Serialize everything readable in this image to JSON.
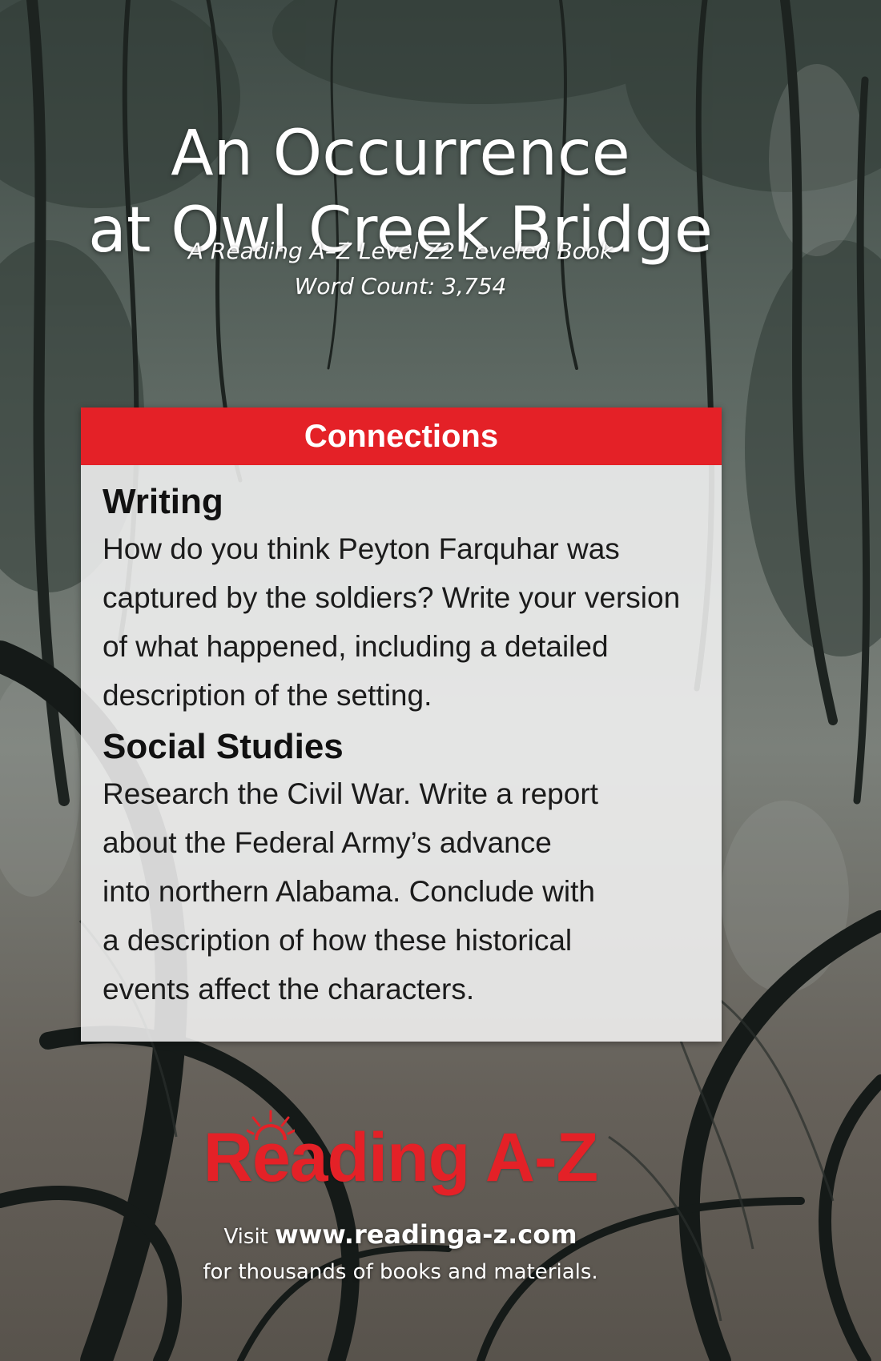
{
  "cover": {
    "title_line_1": "An Occurrence",
    "title_line_2": "at Owl Creek Bridge",
    "subtitle_line_1": "A Reading A–Z Level Z2 Leveled Book",
    "subtitle_line_2": "Word Count: 3,754"
  },
  "connections": {
    "header": "Connections",
    "sections": [
      {
        "heading": "Writing",
        "lines": [
          "How do you think Peyton Farquhar was",
          "captured by the soldiers? Write your version",
          "of what happened, including a detailed",
          "description of the setting."
        ]
      },
      {
        "heading": "Social Studies",
        "lines": [
          "Research the Civil War. Write a report",
          "about the Federal Army’s advance",
          "into northern Alabama. Conclude with",
          "a description of how these historical",
          "events affect the characters."
        ]
      }
    ]
  },
  "footer": {
    "logo": "Reading A-Z",
    "visit_prefix": "Visit ",
    "url": "www.readinga-z.com",
    "tagline": "for thousands of books and materials."
  },
  "colors": {
    "accent_red": "#e42127",
    "panel": "#f6f6f6"
  }
}
